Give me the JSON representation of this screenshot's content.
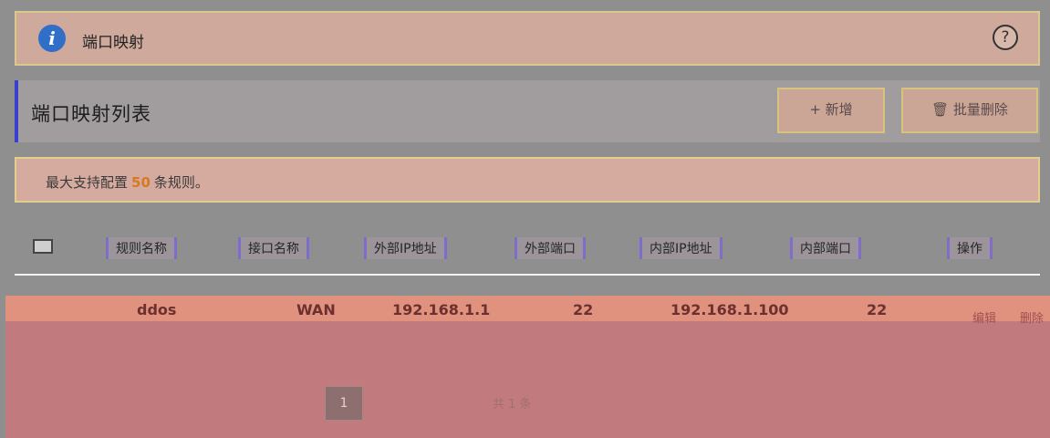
{
  "info": {
    "title": "端口映射",
    "help_icon": "?"
  },
  "list": {
    "title": "端口映射列表",
    "add_label": "+ 新增",
    "delete_label": "批量删除"
  },
  "notice": {
    "prefix": "最大支持配置",
    "max": "50",
    "suffix": "条规则。"
  },
  "table": {
    "columns": [
      "规则名称",
      "接口名称",
      "外部IP地址",
      "外部端口",
      "内部IP地址",
      "内部端口",
      "操作"
    ],
    "row": {
      "name": "ddos",
      "interface": "WAN",
      "external_ip": "192.168.1.1",
      "external_port": "22",
      "internal_ip": "192.168.1.100",
      "internal_port": "22",
      "edit": "编辑",
      "delete": "删除"
    }
  },
  "pagination": {
    "current": "1",
    "total": "共 1 条"
  }
}
